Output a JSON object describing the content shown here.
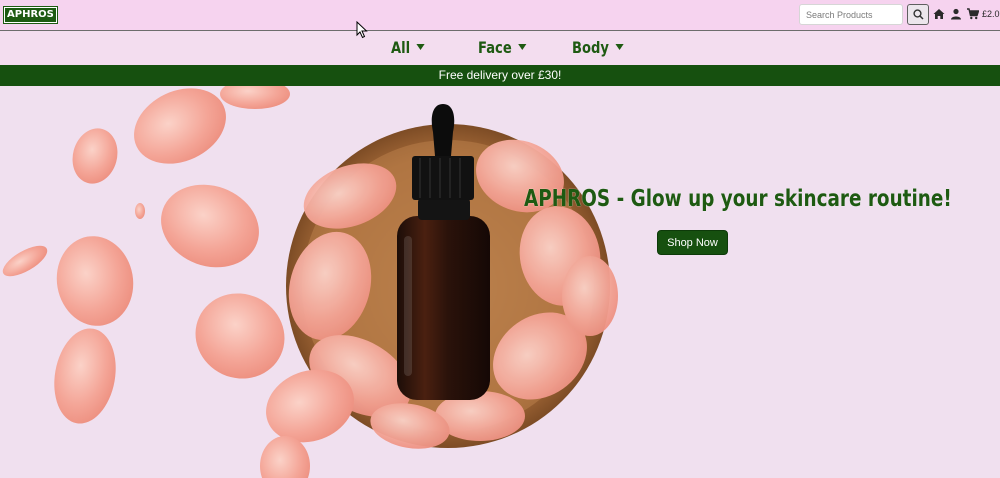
{
  "header": {
    "logo": "APHROS",
    "search": {
      "placeholder": "Search Products",
      "value": ""
    },
    "icons": [
      "search-icon",
      "home-icon",
      "user-icon",
      "cart-icon"
    ],
    "cart_total": "£2.0"
  },
  "nav": {
    "categories": [
      {
        "label": "All"
      },
      {
        "label": "Face"
      },
      {
        "label": "Body"
      }
    ]
  },
  "banner": {
    "text": "Free delivery over £30!"
  },
  "hero": {
    "title": "APHROS - Glow up your skincare routine!",
    "cta": "Shop Now"
  },
  "colors": {
    "brand_green": "#16500f",
    "topbar_pink": "#f6d3ef",
    "hero_bg": "#f0e0ef"
  }
}
